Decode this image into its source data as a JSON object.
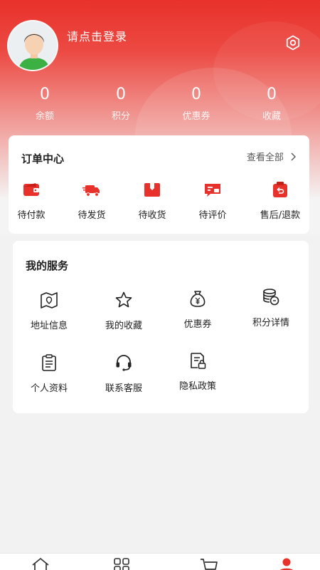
{
  "profile": {
    "login_prompt": "请点击登录",
    "avatar_icon": "user-avatar-icon",
    "settings_icon": "gear-icon"
  },
  "stats": [
    {
      "value": "0",
      "label": "余额"
    },
    {
      "value": "0",
      "label": "积分"
    },
    {
      "value": "0",
      "label": "优惠券"
    },
    {
      "value": "0",
      "label": "收藏"
    }
  ],
  "orders": {
    "title": "订单中心",
    "view_all": "查看全部",
    "items": [
      {
        "label": "待付款",
        "icon": "wallet-icon"
      },
      {
        "label": "待发货",
        "icon": "truck-icon"
      },
      {
        "label": "待收货",
        "icon": "package-icon"
      },
      {
        "label": "待评价",
        "icon": "comment-icon"
      },
      {
        "label": "售后/退款",
        "icon": "refund-icon"
      }
    ]
  },
  "services": {
    "title": "我的服务",
    "items": [
      {
        "label": "地址信息",
        "icon": "map-icon"
      },
      {
        "label": "我的收藏",
        "icon": "star-icon"
      },
      {
        "label": "优惠券",
        "icon": "money-bag-icon"
      },
      {
        "label": "积分详情",
        "icon": "coins-icon"
      },
      {
        "label": "个人资料",
        "icon": "clipboard-icon"
      },
      {
        "label": "联系客服",
        "icon": "headset-icon"
      },
      {
        "label": "隐私政策",
        "icon": "privacy-doc-icon"
      }
    ]
  },
  "tabbar": {
    "active_index": 3,
    "accent": "#e8312a",
    "items": [
      {
        "icon": "home-icon"
      },
      {
        "icon": "category-icon"
      },
      {
        "icon": "cart-icon"
      },
      {
        "icon": "user-icon"
      }
    ]
  },
  "colors": {
    "primary": "#e8312a",
    "background": "#f2f2f2"
  }
}
